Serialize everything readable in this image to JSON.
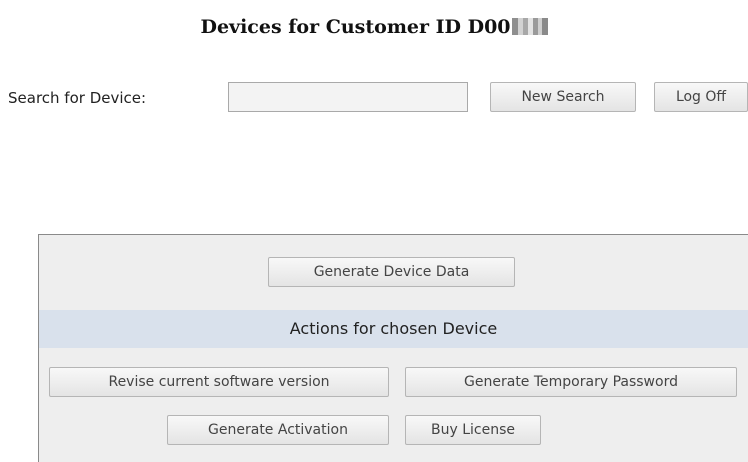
{
  "header": {
    "title": "Devices for Customer ID D00"
  },
  "search": {
    "label": "Search for Device:",
    "value": "",
    "placeholder": "",
    "new_search_label": "New Search",
    "log_off_label": "Log Off"
  },
  "panel": {
    "generate_device_data_label": "Generate Device Data",
    "actions_header": "Actions for chosen Device",
    "buttons": {
      "revise_software": "Revise current software version",
      "generate_temp_password": "Generate Temporary Password",
      "generate_activation": "Generate Activation",
      "buy_license": "Buy License"
    }
  },
  "colors": {
    "panel_background": "#eeeeee",
    "actions_header_background": "#d9e1ec",
    "button_border": "#b5b5b5"
  }
}
